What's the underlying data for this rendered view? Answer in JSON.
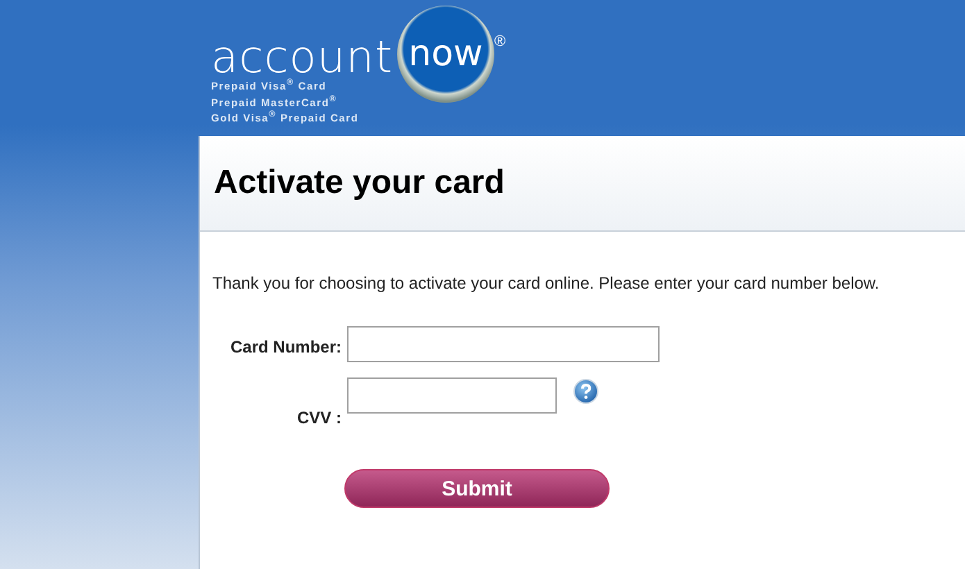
{
  "logo": {
    "word": "account",
    "circle_word": "now",
    "mark": "®",
    "lines": [
      "Prepaid Visa$^{®}$ Card",
      "Prepaid MasterCard$^{®}$",
      "Gold Visa$^{®}$ Prepaid Card"
    ]
  },
  "title": "Activate your card",
  "intro": "Thank you for choosing to activate your card online. Please enter your card number below.",
  "fields": [
    {
      "label": "Card Number:",
      "kind": "wide"
    },
    {
      "label": "CVV :",
      "kind": "help"
    }
  ],
  "submit": "Submit"
}
